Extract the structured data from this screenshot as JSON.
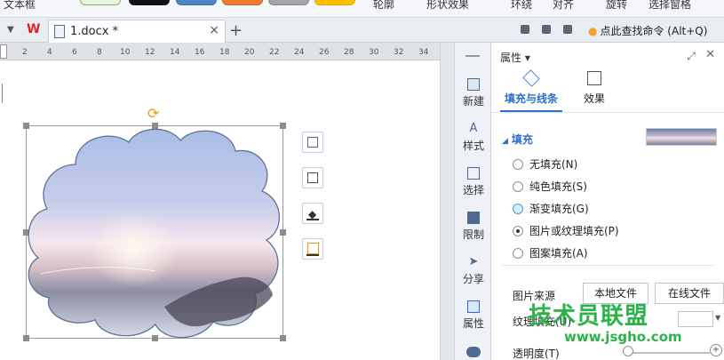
{
  "ribbon": {
    "left_label": "文本框",
    "right_labels": [
      "轮廓",
      "形状效果",
      "环绕",
      "对齐",
      "旋转",
      "选择窗格"
    ]
  },
  "tabs": {
    "document_name": "1.docx *",
    "close": "×",
    "new_tab": "+"
  },
  "toolbar": {
    "find_command": "点此查找命令 (Alt+Q)"
  },
  "ruler": {
    "ticks": [
      "2",
      "4",
      "6",
      "8",
      "10",
      "12",
      "14",
      "16",
      "18",
      "20",
      "22",
      "24",
      "26",
      "28",
      "30",
      "32",
      "34"
    ]
  },
  "rail": {
    "items": [
      {
        "label": "新建",
        "icon": "new-doc-icon"
      },
      {
        "label": "样式",
        "icon": "style-icon"
      },
      {
        "label": "选择",
        "icon": "select-icon"
      },
      {
        "label": "限制",
        "icon": "restrict-icon"
      },
      {
        "label": "分享",
        "icon": "share-icon"
      },
      {
        "label": "属性",
        "icon": "properties-icon"
      }
    ]
  },
  "panel": {
    "title": "属性 ▾",
    "tabs": [
      {
        "label": "填充与线条",
        "icon": "fill-bucket-icon",
        "active": true
      },
      {
        "label": "效果",
        "icon": "cube-icon",
        "active": false
      }
    ],
    "section_title": "填充",
    "fill_options": [
      {
        "label": "无填充(N)",
        "selected": false,
        "highlight": false
      },
      {
        "label": "纯色填充(S)",
        "selected": false,
        "highlight": false
      },
      {
        "label": "渐变填充(G)",
        "selected": false,
        "highlight": true
      },
      {
        "label": "图片或纹理填充(P)",
        "selected": true,
        "highlight": false
      },
      {
        "label": "图案填充(A)",
        "selected": false,
        "highlight": false
      }
    ],
    "picture_source_label": "图片来源",
    "local_file_button": "本地文件",
    "online_file_button": "在线文件",
    "texture_label": "纹理填充(U)",
    "transparency_label": "透明度(T)"
  },
  "watermark": {
    "line1": "技术员联盟",
    "line2": "www.jsgho.com"
  },
  "colors": {
    "accent": "#2a6fc9",
    "wps_red": "#d9232d",
    "watermark_green": "#2bb24a"
  }
}
